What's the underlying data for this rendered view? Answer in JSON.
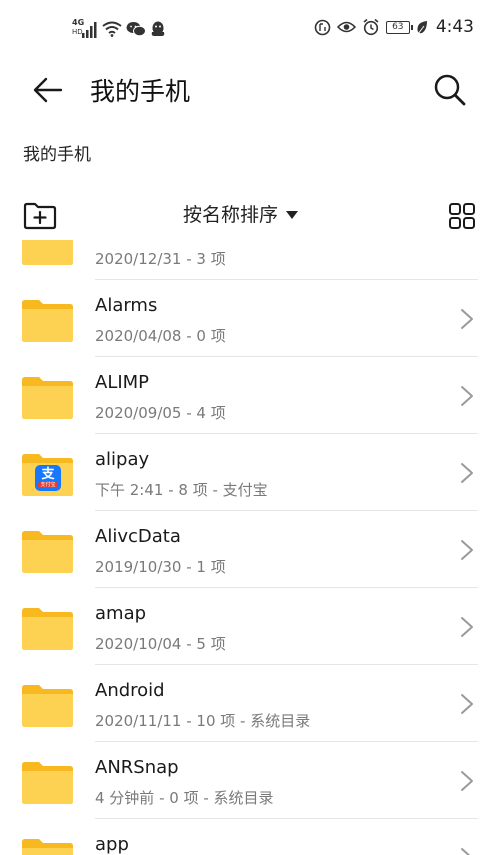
{
  "status_bar": {
    "network": "4G",
    "network_sub": "HD",
    "battery": "63",
    "time": "4:43"
  },
  "app_bar": {
    "title": "我的手机"
  },
  "breadcrumb": "我的手机",
  "toolbar": {
    "sort_label": "按名称排序"
  },
  "files": [
    {
      "name": "",
      "meta": "2020/12/31 - 3 项",
      "icon": "folder-icon"
    },
    {
      "name": "Alarms",
      "meta": "2020/04/08 - 0 项",
      "icon": "folder-icon"
    },
    {
      "name": "ALIMP",
      "meta": "2020/09/05 - 4 项",
      "icon": "folder-icon"
    },
    {
      "name": "alipay",
      "meta": "下午 2:41 - 8 项 - 支付宝",
      "icon": "alipay-folder-icon"
    },
    {
      "name": "AlivcData",
      "meta": "2019/10/30 - 1 项",
      "icon": "folder-icon"
    },
    {
      "name": "amap",
      "meta": "2020/10/04 - 5 项",
      "icon": "folder-icon"
    },
    {
      "name": "Android",
      "meta": "2020/11/11 - 10 项 - 系统目录",
      "icon": "folder-icon"
    },
    {
      "name": "ANRSnap",
      "meta": "4 分钟前 - 0 项 - 系统目录",
      "icon": "folder-icon"
    },
    {
      "name": "app",
      "meta": "",
      "icon": "folder-icon"
    }
  ],
  "alipay_badge": {
    "glyph": "支",
    "text": "支付宝"
  }
}
